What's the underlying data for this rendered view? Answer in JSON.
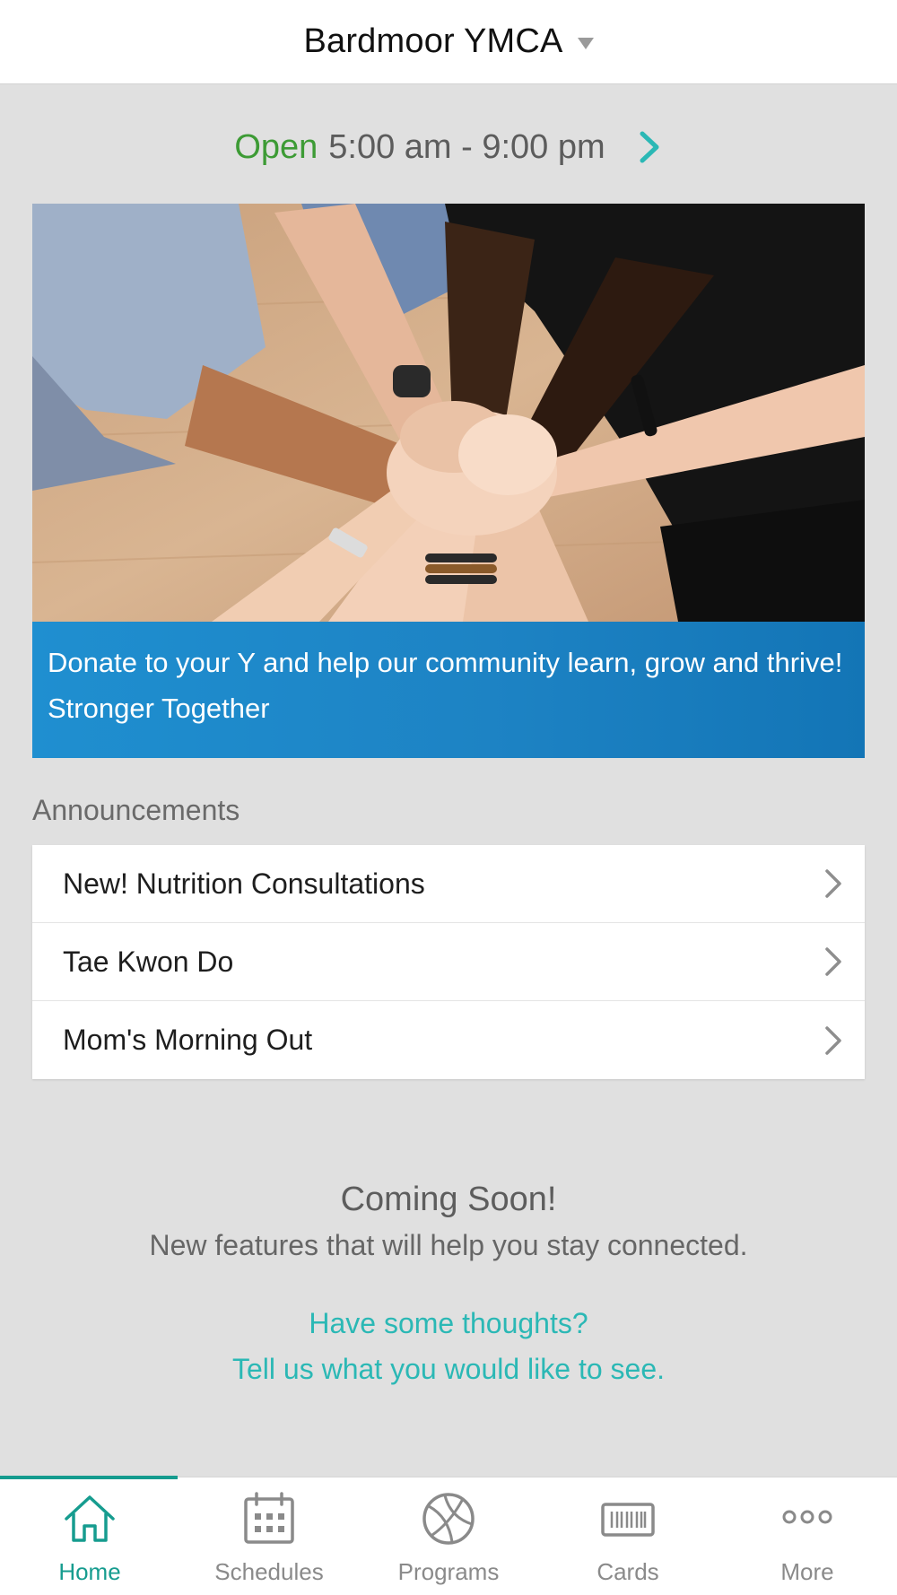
{
  "header": {
    "location_name": "Bardmoor YMCA",
    "dropdown_icon": "caret-down-icon"
  },
  "hours": {
    "status": "Open",
    "time_range": "5:00 am - 9:00 pm",
    "status_color": "#3d9b35",
    "chevron_icon": "chevron-right-icon"
  },
  "hero": {
    "caption": "Donate to your Y and help our community learn, grow and thrive! Stronger Together",
    "caption_bg": "#1d83c4"
  },
  "announcements": {
    "heading": "Announcements",
    "items": [
      {
        "label": "New! Nutrition Consultations"
      },
      {
        "label": "Tae Kwon Do"
      },
      {
        "label": "Mom's Morning Out"
      }
    ]
  },
  "coming_soon": {
    "title": "Coming Soon!",
    "subtitle": "New features that will help you stay connected.",
    "feedback_line1": "Have some thoughts?",
    "feedback_line2": "Tell us what you would like to see."
  },
  "tabs": [
    {
      "label": "Home",
      "icon": "home-icon",
      "active": true
    },
    {
      "label": "Schedules",
      "icon": "calendar-icon",
      "active": false
    },
    {
      "label": "Programs",
      "icon": "basketball-icon",
      "active": false
    },
    {
      "label": "Cards",
      "icon": "barcode-card-icon",
      "active": false
    },
    {
      "label": "More",
      "icon": "more-dots-icon",
      "active": false
    }
  ],
  "colors": {
    "accent_teal": "#2bb8b5",
    "active_tab": "#169c8f",
    "background": "#e0e0e0"
  }
}
